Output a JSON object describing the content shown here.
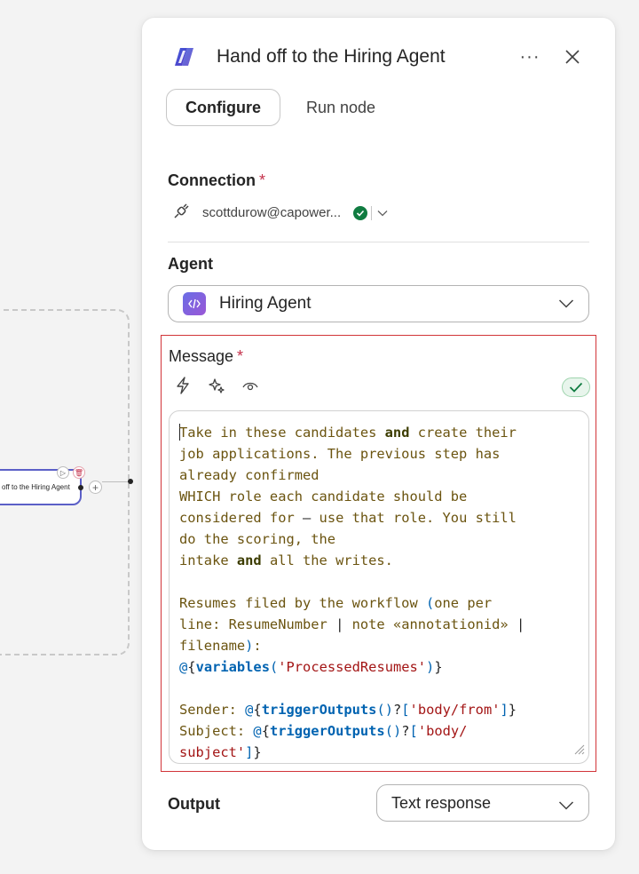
{
  "canvas": {
    "node_label": "off to the Hiring Agent"
  },
  "panel": {
    "title": "Hand off to the Hiring Agent",
    "tabs": [
      {
        "label": "Configure",
        "active": true
      },
      {
        "label": "Run node",
        "active": false
      }
    ],
    "connection": {
      "label": "Connection",
      "required_mark": "*",
      "account": "scottdurow@capower...",
      "status": "connected"
    },
    "agent": {
      "label": "Agent",
      "selected": "Hiring Agent"
    },
    "message": {
      "label": "Message",
      "required_mark": "*",
      "tools": [
        "lightning-icon",
        "sparkle-icon",
        "eye-icon"
      ],
      "valid": true
    },
    "output": {
      "label": "Output",
      "selected": "Text response"
    }
  },
  "colors": {
    "accent": "#5b5fc7",
    "required": "#c4314b",
    "error_border": "#d13438",
    "success": "#107c41"
  }
}
